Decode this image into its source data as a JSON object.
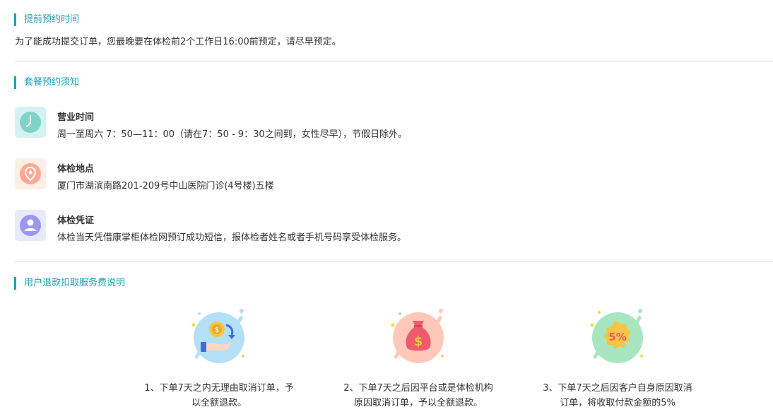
{
  "advance": {
    "title": "提前预约时间",
    "text": "为了能成功提交订单，您最晚要在体检前2个工作日16:00前预定，请尽早预定。"
  },
  "notice": {
    "title": "套餐预约须知",
    "items": [
      {
        "icon": "clock-icon",
        "title": "营业时间",
        "desc": "周一至周六 7：50—11：00（请在7：50 - 9：30之间到，女性尽早），节假日除外。"
      },
      {
        "icon": "location-pin-icon",
        "title": "体检地点",
        "desc": "厦门市湖滨南路201-209号中山医院门诊(4号楼)五楼"
      },
      {
        "icon": "user-id-icon",
        "title": "体检凭证",
        "desc": "体检当天凭借康掌柜体检网预订成功短信，报体检者姓名或者手机号码享受体检服务。"
      }
    ]
  },
  "refund": {
    "title": "用户退款扣取服务费说明",
    "items": [
      {
        "icon": "coin-hand-icon",
        "line1": "1、下单7天之内无理由取消订单，予",
        "line2": "以全额退款。"
      },
      {
        "icon": "money-bag-icon",
        "line1": "2、下单7天之后因平台或是体检机构",
        "line2": "原因取消订单，予以全额退款。"
      },
      {
        "icon": "percent-badge-icon",
        "line1": "3、下单7天之后因客户自身原因取消",
        "line2": "订单，将收取付款金额的5%",
        "badge": "5%"
      }
    ]
  },
  "colors": {
    "accent": "#17a2b8",
    "clock_bg": "#d4f1f3",
    "clock": "#7fd3c8",
    "pin_bg": "#fdeee6",
    "pin": "#ffa995",
    "user_bg": "#e8e9fb",
    "user": "#9c98f0"
  }
}
